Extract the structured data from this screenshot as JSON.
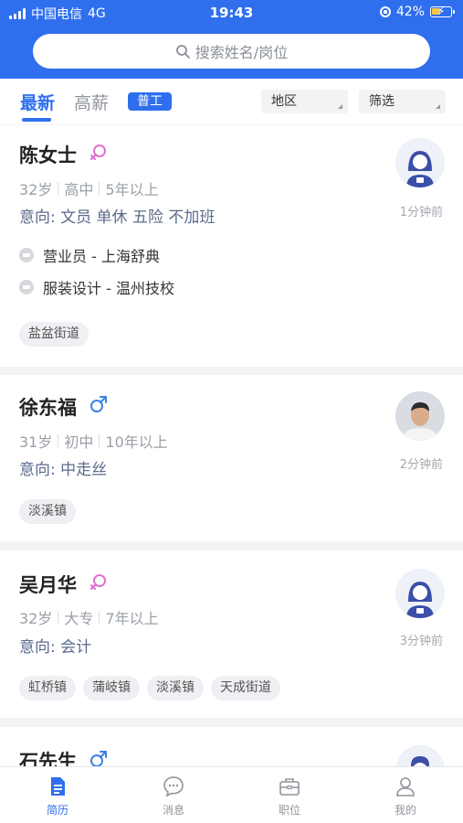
{
  "status_bar": {
    "carrier": "中国电信",
    "network": "4G",
    "time": "19:43",
    "battery": "42%"
  },
  "search": {
    "placeholder": "搜索姓名/岗位"
  },
  "tabs": [
    {
      "label": "最新"
    },
    {
      "label": "高薪"
    },
    {
      "label": "普工"
    }
  ],
  "filters": [
    {
      "label": "地区"
    },
    {
      "label": "筛选"
    }
  ],
  "candidates": [
    {
      "name": "陈女士",
      "gender": "female",
      "age": "32岁",
      "education": "高中",
      "experience": "5年以上",
      "intent": "意向: 文员  单休  五险 不加班",
      "history": [
        {
          "text": "营业员 - 上海舒典"
        },
        {
          "text": "服装设计 - 温州技校"
        }
      ],
      "tags": [
        "盐盆街道"
      ],
      "time_ago": "1分钟前",
      "avatar": "female-placeholder-avatar"
    },
    {
      "name": "徐东福",
      "gender": "male",
      "age": "31岁",
      "education": "初中",
      "experience": "10年以上",
      "intent": "意向: 中走丝",
      "history": [],
      "tags": [
        "淡溪镇"
      ],
      "time_ago": "2分钟前",
      "avatar": "user-photo-avatar"
    },
    {
      "name": "吴月华",
      "gender": "female",
      "age": "32岁",
      "education": "大专",
      "experience": "7年以上",
      "intent": "意向: 会计",
      "history": [],
      "tags": [
        "虹桥镇",
        "蒲岐镇",
        "淡溪镇",
        "天成街道"
      ],
      "time_ago": "3分钟前",
      "avatar": "female-placeholder-avatar"
    },
    {
      "name": "石先生",
      "gender": "male",
      "avatar": "male-placeholder-avatar"
    }
  ],
  "bottom_nav": [
    {
      "label": "简历",
      "icon": "resume-icon",
      "active": true
    },
    {
      "label": "消息",
      "icon": "message-icon",
      "active": false
    },
    {
      "label": "职位",
      "icon": "briefcase-icon",
      "active": false
    },
    {
      "label": "我的",
      "icon": "profile-icon",
      "active": false
    }
  ],
  "colors": {
    "brand": "#2f6fee",
    "female": "#e06fd0",
    "male": "#3b82e6"
  }
}
